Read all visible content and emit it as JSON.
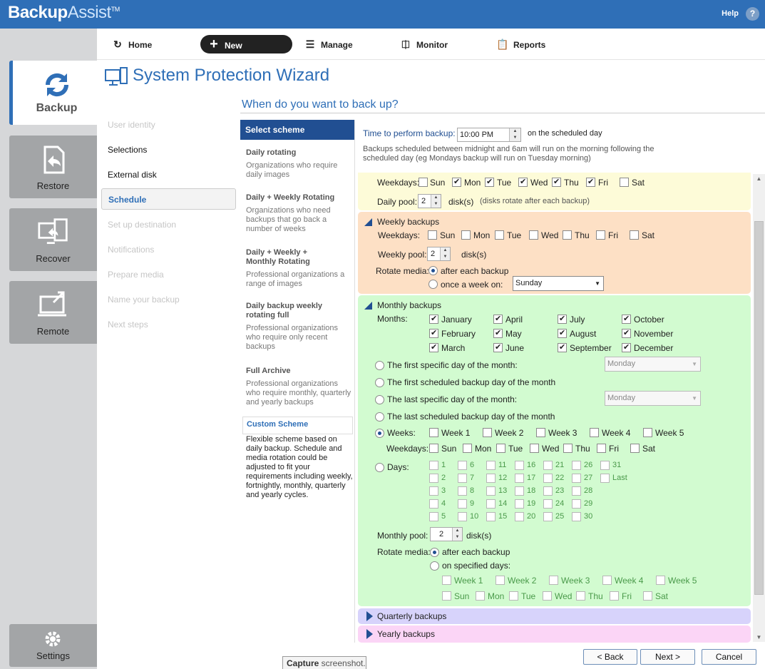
{
  "app": {
    "brand_bold": "Backup",
    "brand_light": "Assist",
    "tm": "TM",
    "help": "Help",
    "help_icon": "?"
  },
  "nav": [
    {
      "label": "Backup",
      "icon": "refresh-icon"
    },
    {
      "label": "Restore",
      "icon": "restore-icon"
    },
    {
      "label": "Recover",
      "icon": "recover-icon"
    },
    {
      "label": "Remote",
      "icon": "remote-icon"
    },
    {
      "label": "Settings",
      "icon": "gear-icon"
    }
  ],
  "toolbar": {
    "home": "Home",
    "new": "New",
    "manage": "Manage",
    "monitor": "Monitor",
    "reports": "Reports"
  },
  "wizard": {
    "title": "System Protection Wizard",
    "question": "When do you want to back up?"
  },
  "steps": [
    "User identity",
    "Selections",
    "External disk",
    "Schedule",
    "Set up destination",
    "Notifications",
    "Prepare media",
    "Name your backup",
    "Next steps"
  ],
  "schemes": {
    "header": "Select scheme",
    "items": [
      {
        "title": "Daily rotating",
        "desc": "Organizations who require daily images"
      },
      {
        "title": "Daily + Weekly Rotating",
        "desc": "Organizations who need backups that go back a number of weeks"
      },
      {
        "title": "Daily + Weekly + Monthly Rotating",
        "desc": "Professional organizations a range of images"
      },
      {
        "title": "Daily backup weekly rotating full",
        "desc": "Professional organizations who require only recent backups"
      },
      {
        "title": "Full Archive",
        "desc": "Professional organizations who require monthly, quarterly and yearly backups"
      },
      {
        "title": "Custom Scheme",
        "desc": "Flexible scheme based on daily backup. Schedule and media rotation could be adjusted to fit your requirements including weekly, fortnightly, monthly, quarterly and yearly cycles."
      }
    ]
  },
  "time": {
    "label": "Time to perform backup:",
    "value": "10:00 PM",
    "suffix": "on the scheduled day",
    "note": "Backups scheduled between midnight and 6am will run on the morning following the scheduled day (eg Mondays backup will run on Tuesday morning)"
  },
  "daily": {
    "weekdays_label": "Weekdays:",
    "days": [
      {
        "d": "Sun",
        "on": false
      },
      {
        "d": "Mon",
        "on": true
      },
      {
        "d": "Tue",
        "on": true
      },
      {
        "d": "Wed",
        "on": true
      },
      {
        "d": "Thu",
        "on": true
      },
      {
        "d": "Fri",
        "on": true
      },
      {
        "d": "Sat",
        "on": false
      }
    ],
    "pool_label": "Daily pool:",
    "pool": "2",
    "pool_unit": "disk(s)",
    "pool_note": "(disks rotate after each backup)"
  },
  "weekly": {
    "title": "Weekly backups",
    "weekdays_label": "Weekdays:",
    "days": [
      "Sun",
      "Mon",
      "Tue",
      "Wed",
      "Thu",
      "Fri",
      "Sat"
    ],
    "pool_label": "Weekly pool:",
    "pool": "2",
    "pool_unit": "disk(s)",
    "rotate_label": "Rotate media:",
    "opt1": "after each backup",
    "opt2": "once a week on:",
    "combo": "Sunday"
  },
  "monthly": {
    "title": "Monthly backups",
    "months_label": "Months:",
    "months": [
      "January",
      "February",
      "March",
      "April",
      "May",
      "June",
      "July",
      "August",
      "September",
      "October",
      "November",
      "December"
    ],
    "opt_first_specific": "The first specific day of the month:",
    "opt_first_sched": "The first scheduled backup day of the month",
    "opt_last_specific": "The last specific day of the month:",
    "opt_last_sched": "The last scheduled backup day of the month",
    "combo1": "Monday",
    "combo2": "Monday",
    "weeks_label": "Weeks:",
    "weeks": [
      "Week 1",
      "Week 2",
      "Week 3",
      "Week 4",
      "Week 5"
    ],
    "weekdays_label": "Weekdays:",
    "days": [
      "Sun",
      "Mon",
      "Tue",
      "Wed",
      "Thu",
      "Fri",
      "Sat"
    ],
    "days_label": "Days:",
    "day_cols": [
      [
        "1",
        "2",
        "3",
        "4",
        "5"
      ],
      [
        "6",
        "7",
        "8",
        "9",
        "10"
      ],
      [
        "11",
        "12",
        "13",
        "14",
        "15"
      ],
      [
        "16",
        "17",
        "18",
        "19",
        "20"
      ],
      [
        "21",
        "22",
        "23",
        "24",
        "25"
      ],
      [
        "26",
        "27",
        "28",
        "29",
        "30"
      ],
      [
        "31",
        "Last"
      ]
    ],
    "pool_label": "Monthly pool:",
    "pool": "2",
    "pool_unit": "disk(s)",
    "rotate_label": "Rotate media:",
    "rot1": "after each backup",
    "rot2": "on specified days:",
    "rot_weeks": [
      "Week 1",
      "Week 2",
      "Week 3",
      "Week 4",
      "Week 5"
    ],
    "rot_days": [
      "Sun",
      "Mon",
      "Tue",
      "Wed",
      "Thu",
      "Fri",
      "Sat"
    ]
  },
  "quarterly": {
    "title": "Quarterly backups"
  },
  "yearly": {
    "title": "Yearly backups"
  },
  "buttons": {
    "back": "< Back",
    "next": "Next >",
    "cancel": "Cancel"
  },
  "tooltip": {
    "bold": "Capture",
    "rest": " screenshot."
  }
}
